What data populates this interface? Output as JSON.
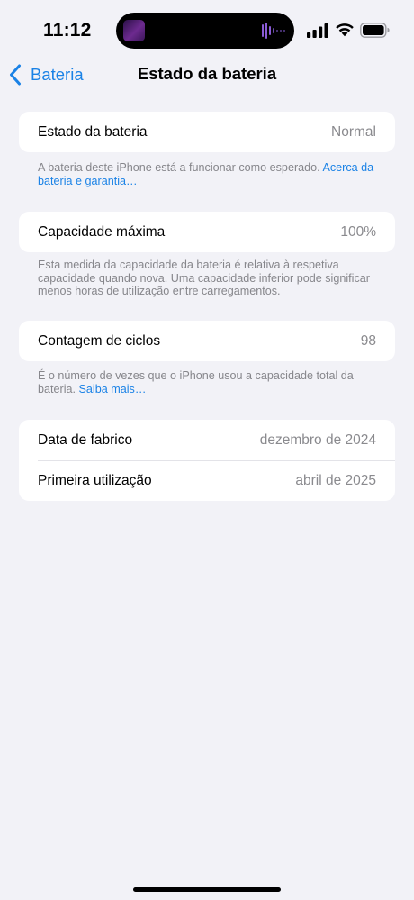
{
  "status_bar": {
    "time": "11:12"
  },
  "nav": {
    "back_label": "Bateria",
    "title": "Estado da bateria"
  },
  "health": {
    "label": "Estado da bateria",
    "value": "Normal",
    "footnote": "A bateria deste iPhone está a funcionar como esperado.",
    "footnote_link": "Acerca da bateria e garantia…"
  },
  "capacity": {
    "label": "Capacidade máxima",
    "value": "100%",
    "footnote": "Esta medida da capacidade da bateria é relativa à respetiva capacidade quando nova. Uma capacidade inferior pode significar menos horas de utilização entre carregamentos."
  },
  "cycles": {
    "label": "Contagem de ciclos",
    "value": "98",
    "footnote": "É o número de vezes que o iPhone usou a capacidade total da bateria.",
    "footnote_link": "Saiba mais…"
  },
  "dates": {
    "manufacture_label": "Data de fabrico",
    "manufacture_value": "dezembro de 2024",
    "first_use_label": "Primeira utilização",
    "first_use_value": "abril de 2025"
  },
  "colors": {
    "accent": "#1a82e6",
    "background": "#f2f2f7",
    "secondary_text": "#8a8a8e"
  },
  "icons": {
    "back": "chevron-left-icon",
    "signal": "cellular-signal-icon",
    "wifi": "wifi-icon",
    "battery": "battery-icon",
    "now_playing": "audio-waveform-icon"
  }
}
